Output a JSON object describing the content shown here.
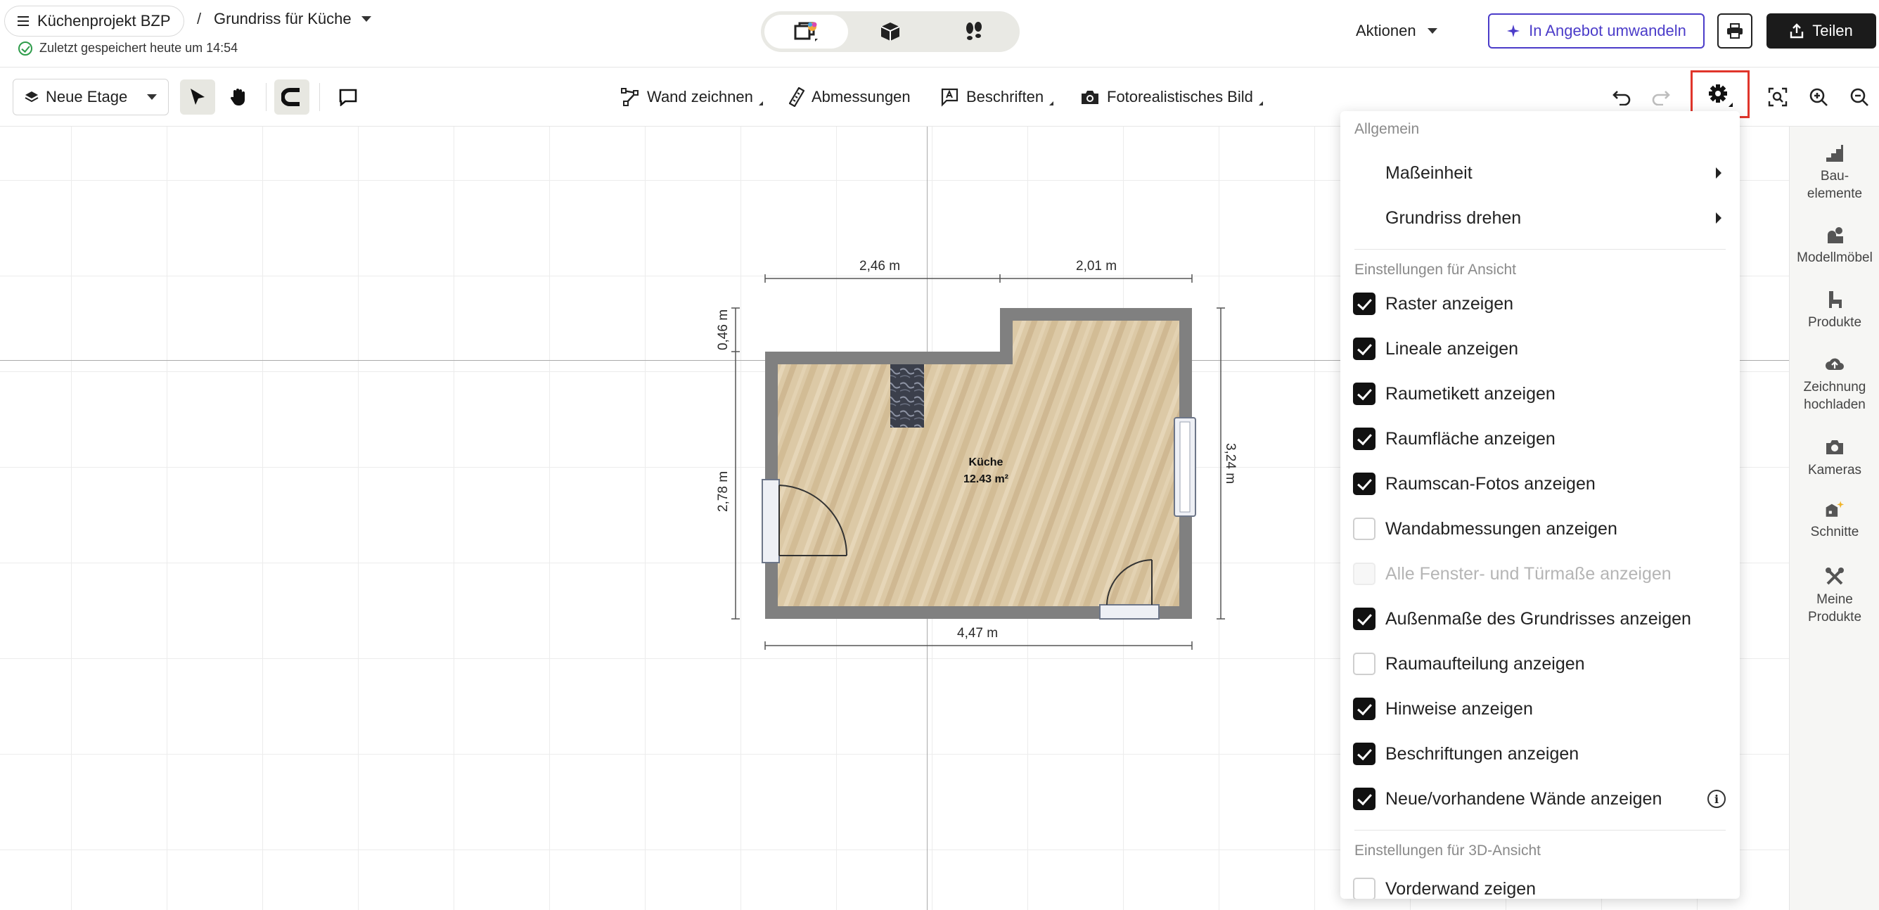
{
  "header": {
    "project_name": "Küchenprojekt BZP",
    "separator": "/",
    "plan_name": "Grundriss für Küche",
    "saved_status": "Zuletzt gespeichert heute um 14:54",
    "actions_label": "Aktionen",
    "offer_label": "In Angebot umwandeln",
    "share_label": "Teilen",
    "view_modes": [
      "2d-view-icon",
      "3d-view-icon",
      "walkthrough-icon"
    ],
    "active_view": 0
  },
  "toolbar": {
    "floor_label": "Neue Etage",
    "tools": {
      "wall": "Wand zeichnen",
      "dimensions": "Abmessungen",
      "labels": "Beschriften",
      "photo": "Fotorealistisches Bild"
    }
  },
  "canvas": {
    "dimensions": {
      "top_left": "2,46 m",
      "top_right": "2,01 m",
      "left_upper": "0,46 m",
      "left_lower": "2,78 m",
      "right": "3,24 m",
      "bottom": "4,47 m"
    },
    "room": {
      "name": "Küche",
      "area": "12.43 m²"
    }
  },
  "rail": {
    "items": [
      {
        "label": "Bau-\nelemente",
        "icon": "stairs-icon"
      },
      {
        "label": "Modellmöbel",
        "icon": "furniture-icon"
      },
      {
        "label": "Produkte",
        "icon": "chair-icon"
      },
      {
        "label": "Zeichnung\nhochladen",
        "icon": "upload-icon"
      },
      {
        "label": "Kameras",
        "icon": "camera-icon"
      },
      {
        "label": "Schnitte",
        "icon": "sections-icon"
      },
      {
        "label": "Meine\nProdukte",
        "icon": "tools-icon"
      }
    ]
  },
  "settings_menu": {
    "section_general": "Allgemein",
    "unit": "Maßeinheit",
    "rotate": "Grundriss drehen",
    "section_view": "Einstellungen für Ansicht",
    "options": [
      {
        "label": "Raster anzeigen",
        "checked": true
      },
      {
        "label": "Lineale anzeigen",
        "checked": true
      },
      {
        "label": "Raumetikett anzeigen",
        "checked": true
      },
      {
        "label": "Raumfläche anzeigen",
        "checked": true
      },
      {
        "label": "Raumscan-Fotos anzeigen",
        "checked": true
      },
      {
        "label": "Wandabmessungen anzeigen",
        "checked": false
      },
      {
        "label": "Alle Fenster- und Türmaße anzeigen",
        "checked": false,
        "disabled": true
      },
      {
        "label": "Außenmaße des Grundrisses anzeigen",
        "checked": true
      },
      {
        "label": "Raumaufteilung anzeigen",
        "checked": false
      },
      {
        "label": "Hinweise anzeigen",
        "checked": true
      },
      {
        "label": "Beschriftungen anzeigen",
        "checked": true
      },
      {
        "label": "Neue/vorhandene Wände anzeigen",
        "checked": true,
        "info": true
      }
    ],
    "section_3d": "Einstellungen für 3D-Ansicht",
    "option_3d": "Vorderwand zeigen"
  },
  "colors": {
    "accent": "#4b3cc9",
    "highlight": "#e0352b",
    "saved_ok": "#2e9c4a",
    "wall": "#808080",
    "floor": "#dcc9a6"
  }
}
